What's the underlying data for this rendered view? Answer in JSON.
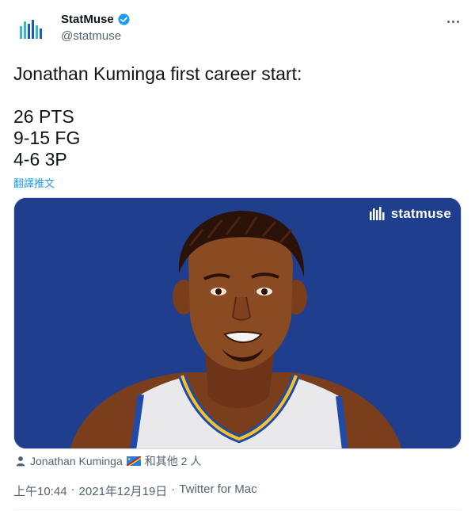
{
  "account": {
    "display_name": "StatMuse",
    "handle": "@statmuse",
    "verified": true,
    "avatar_icon": "statmuse-logo-icon"
  },
  "more_icon": "more-horizontal-icon",
  "tweet": {
    "lines": [
      "Jonathan Kuminga first career start:",
      "",
      "26 PTS",
      "9-15 FG",
      "4-6 3P"
    ],
    "translate_label": "翻譯推文"
  },
  "media": {
    "brand_text": "statmuse",
    "background_color": "#1f3f8e",
    "accent_color": "#f5c22b"
  },
  "tags": {
    "icon": "person-icon",
    "name": "Jonathan Kuminga",
    "flag": "dr-congo-flag-icon",
    "others": "和其他 2 人"
  },
  "meta": {
    "time": "上午10:44",
    "sep1": "·",
    "date": "2021年12月19日",
    "sep2": "·",
    "source": "Twitter for Mac"
  },
  "colors": {
    "link": "#1d9bf0",
    "muted": "#536471",
    "text": "#0f1419"
  }
}
